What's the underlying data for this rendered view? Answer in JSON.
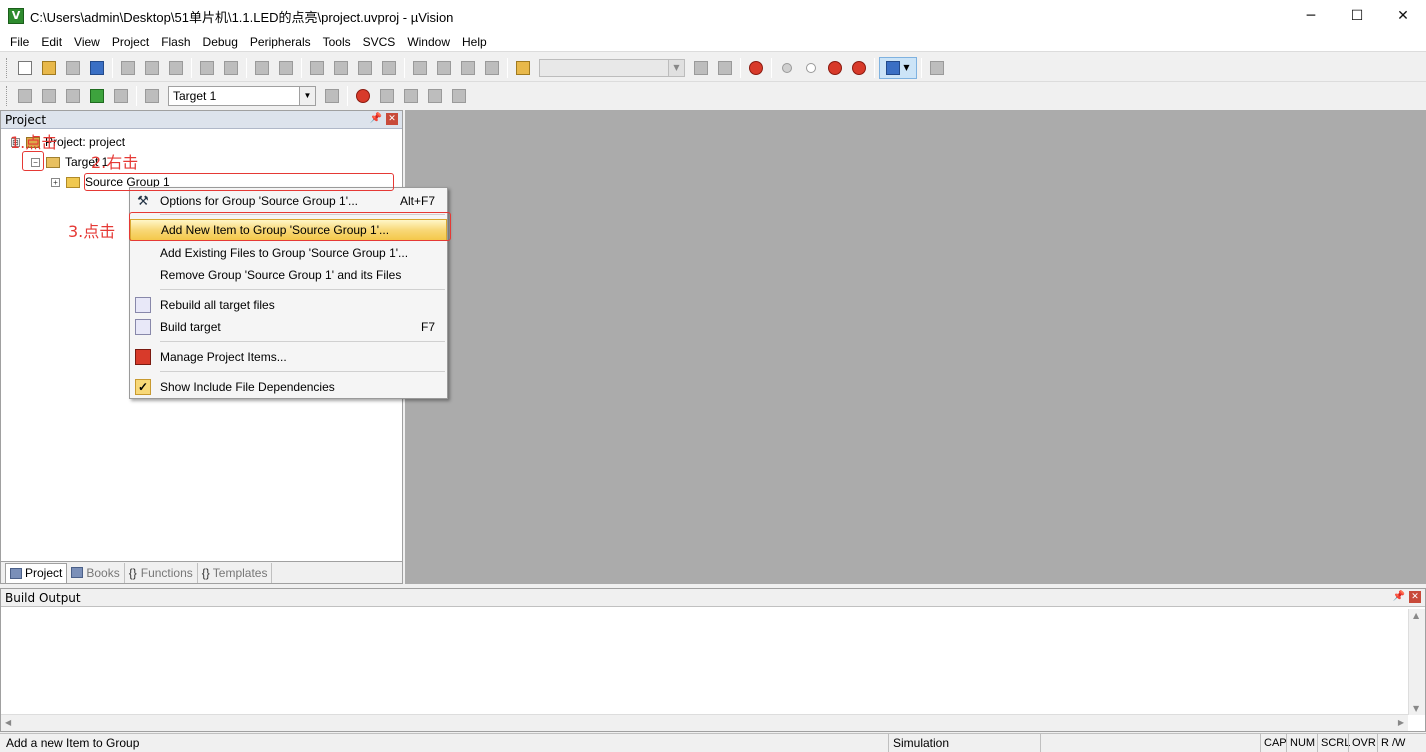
{
  "window": {
    "title": "C:\\Users\\admin\\Desktop\\51单片机\\1.1.LED的点亮\\project.uvproj - µVision",
    "app_icon_glyph": "V",
    "minimize_glyph": "─",
    "maximize_glyph": "☐",
    "close_glyph": "✕"
  },
  "menu": [
    "File",
    "Edit",
    "View",
    "Project",
    "Flash",
    "Debug",
    "Peripherals",
    "Tools",
    "SVCS",
    "Window",
    "Help"
  ],
  "toolbar2": {
    "target_value": "Target 1",
    "target_arrow": "▼"
  },
  "project_panel": {
    "title": "Project",
    "pin_glyph": "📌",
    "close_glyph": "✕",
    "tree": {
      "root_label": "Project: project",
      "root_expander": "⊟",
      "target_label": "Target 1",
      "target_expander": "−",
      "group_label": "Source Group 1",
      "group_expander": "+"
    },
    "tabs": [
      {
        "label": "Project",
        "active": true
      },
      {
        "label": "Books",
        "active": false
      },
      {
        "label": "Functions",
        "active": false
      },
      {
        "label": "Templates",
        "active": false
      }
    ]
  },
  "build_output": {
    "title": "Build Output",
    "pin_glyph": "📌",
    "close_glyph": "✕"
  },
  "context_menu": {
    "items": [
      {
        "label": "Options for Group 'Source Group 1'...",
        "shortcut": "Alt+F7",
        "icon": "options-icon"
      },
      {
        "label": "Add New  Item to Group 'Source Group 1'...",
        "shortcut": "",
        "icon": "none",
        "highlighted": true
      },
      {
        "label": "Add Existing Files to Group 'Source Group 1'...",
        "shortcut": "",
        "icon": "none"
      },
      {
        "label": "Remove Group 'Source Group 1' and its Files",
        "shortcut": "",
        "icon": "none"
      },
      {
        "label": "Rebuild all target files",
        "shortcut": "",
        "icon": "rebuild-icon"
      },
      {
        "label": "Build target",
        "shortcut": "F7",
        "icon": "build-icon"
      },
      {
        "label": "Manage Project Items...",
        "shortcut": "",
        "icon": "manage-icon"
      },
      {
        "label": "Show Include File Dependencies",
        "shortcut": "",
        "icon": "check-icon"
      }
    ],
    "options_glyph": "⚒",
    "check_glyph": "✓"
  },
  "annotations": {
    "step1": "1.点击",
    "step2": "2.右击",
    "step3": "3.点击"
  },
  "statusbar": {
    "message": "Add a new Item to Group",
    "mode": "Simulation",
    "indicators": [
      "CAP",
      "NUM",
      "SCRL",
      "OVR",
      "R /W"
    ]
  },
  "colors": {
    "accent_highlight": "#f8d878",
    "annotation_red": "#e53935",
    "editor_bg": "#ababab"
  }
}
